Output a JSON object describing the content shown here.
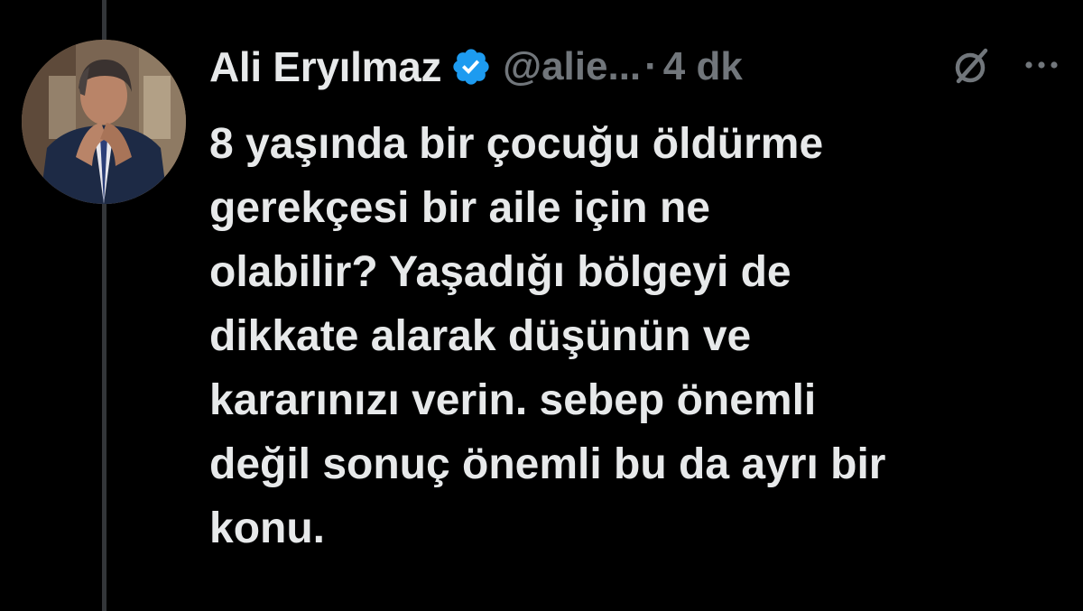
{
  "tweet": {
    "author_name": "Ali Eryılmaz",
    "handle": "@alie...",
    "separator": "·",
    "time": "4 dk",
    "verified": true,
    "text_lines": [
      "8 yaşında bir çocuğu öldürme",
      "gerekçesi bir aile için ne",
      "olabilir? Yaşadığı bölgeyi de",
      "dikkate alarak düşünün ve",
      "kararınızı verin. sebep önemli",
      "değil sonuç önemli bu da ayrı bir",
      "konu."
    ]
  },
  "icons": {
    "verified": "verified-badge-icon",
    "grok": "grok-icon",
    "more": "more-options-icon"
  },
  "colors": {
    "background": "#000000",
    "text": "#e7e9ea",
    "muted": "#71767b",
    "verified": "#1d9bf0",
    "thread_line": "#333639"
  }
}
